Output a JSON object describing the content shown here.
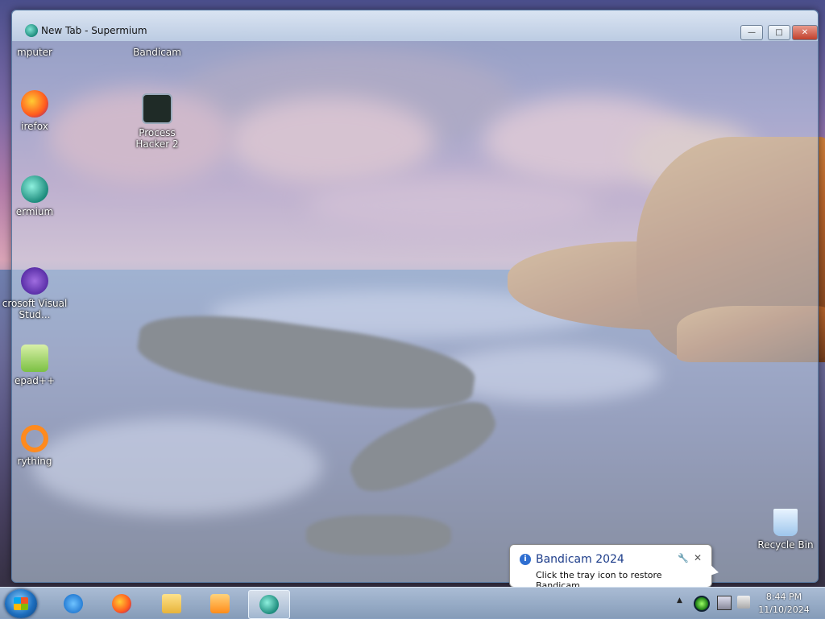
{
  "window": {
    "title": "New Tab - Supermium",
    "controls": {
      "minimize": "—",
      "maximize": "□",
      "close": "✕"
    }
  },
  "desktop": {
    "icons": [
      {
        "label": "mputer",
        "icon": "computer-icon"
      },
      {
        "label": "Bandicam",
        "icon": "bandicam-icon"
      },
      {
        "label": "irefox",
        "icon": "firefox-icon"
      },
      {
        "label": "Process Hacker 2",
        "icon": "process-hacker-icon"
      },
      {
        "label": "ermium",
        "icon": "supermium-icon"
      },
      {
        "label": "crosoft Visual Stud...",
        "icon": "visual-studio-icon"
      },
      {
        "label": "epad++",
        "icon": "notepadpp-icon"
      },
      {
        "label": "rything",
        "icon": "everything-icon"
      },
      {
        "label": "Recycle Bin",
        "icon": "recycle-bin-icon"
      }
    ]
  },
  "notification": {
    "title": "Bandicam 2024",
    "body": "Click the tray icon to restore Bandicam.",
    "settings_icon": "🔧",
    "close": "✕",
    "info_icon": "i"
  },
  "taskbar": {
    "apps": [
      {
        "name": "internet-explorer",
        "icon": "internet-explorer-icon"
      },
      {
        "name": "firefox",
        "icon": "firefox-icon"
      },
      {
        "name": "file-explorer",
        "icon": "folder-icon"
      },
      {
        "name": "media-player",
        "icon": "media-player-icon"
      },
      {
        "name": "supermium",
        "icon": "supermium-icon",
        "active": true
      }
    ],
    "tray": {
      "arrow": "▲",
      "time": "8:44 PM",
      "date": "11/10/2024"
    }
  }
}
